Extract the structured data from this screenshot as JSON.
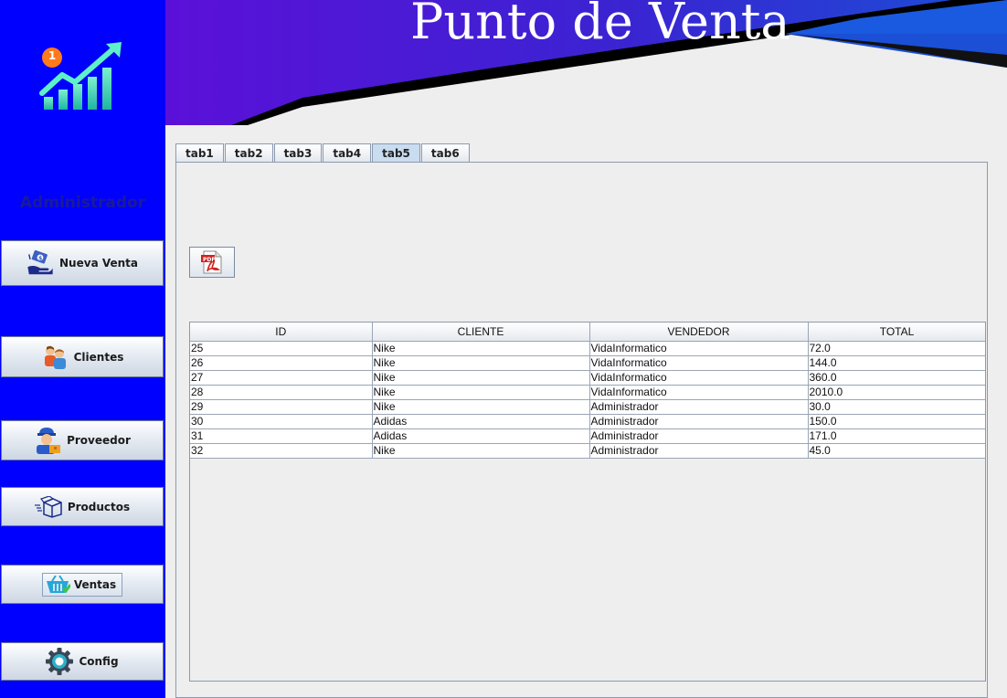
{
  "window": {
    "title": "Punto de Venta"
  },
  "user": {
    "role": "Administrador",
    "badge_count": "1"
  },
  "sidebar": {
    "items": [
      {
        "label": "Nueva Venta",
        "icon": "payment-hand-icon"
      },
      {
        "label": "Clientes",
        "icon": "people-icon"
      },
      {
        "label": "Proveedor",
        "icon": "delivery-man-icon"
      },
      {
        "label": "Productos",
        "icon": "box-icon"
      },
      {
        "label": "Ventas",
        "icon": "basket-icon"
      },
      {
        "label": "Config",
        "icon": "gear-icon"
      }
    ]
  },
  "tabs": [
    {
      "label": "tab1",
      "selected": false
    },
    {
      "label": "tab2",
      "selected": false
    },
    {
      "label": "tab3",
      "selected": false
    },
    {
      "label": "tab4",
      "selected": false
    },
    {
      "label": "tab5",
      "selected": true
    },
    {
      "label": "tab6",
      "selected": false
    }
  ],
  "toolbar": {
    "pdf_icon": "pdf-icon",
    "pdf_icon_text": "PDF"
  },
  "table": {
    "columns": [
      "ID",
      "CLIENTE",
      "VENDEDOR",
      "TOTAL"
    ],
    "rows": [
      [
        "25",
        "Nike",
        "VidaInformatico",
        "72.0"
      ],
      [
        "26",
        "Nike",
        "VidaInformatico",
        "144.0"
      ],
      [
        "27",
        "Nike",
        "VidaInformatico",
        "360.0"
      ],
      [
        "28",
        "Nike",
        "VidaInformatico",
        "2010.0"
      ],
      [
        "29",
        "Nike",
        "Administrador",
        "30.0"
      ],
      [
        "30",
        "Adidas",
        "Administrador",
        "150.0"
      ],
      [
        "31",
        "Adidas",
        "Administrador",
        "171.0"
      ],
      [
        "32",
        "Nike",
        "Administrador",
        "45.0"
      ]
    ]
  },
  "colors": {
    "sidebar": "#0000ff",
    "banner_left": "#5b10d8",
    "banner_right": "#1a4fd6",
    "selected_tab": "#c9dcf0"
  }
}
